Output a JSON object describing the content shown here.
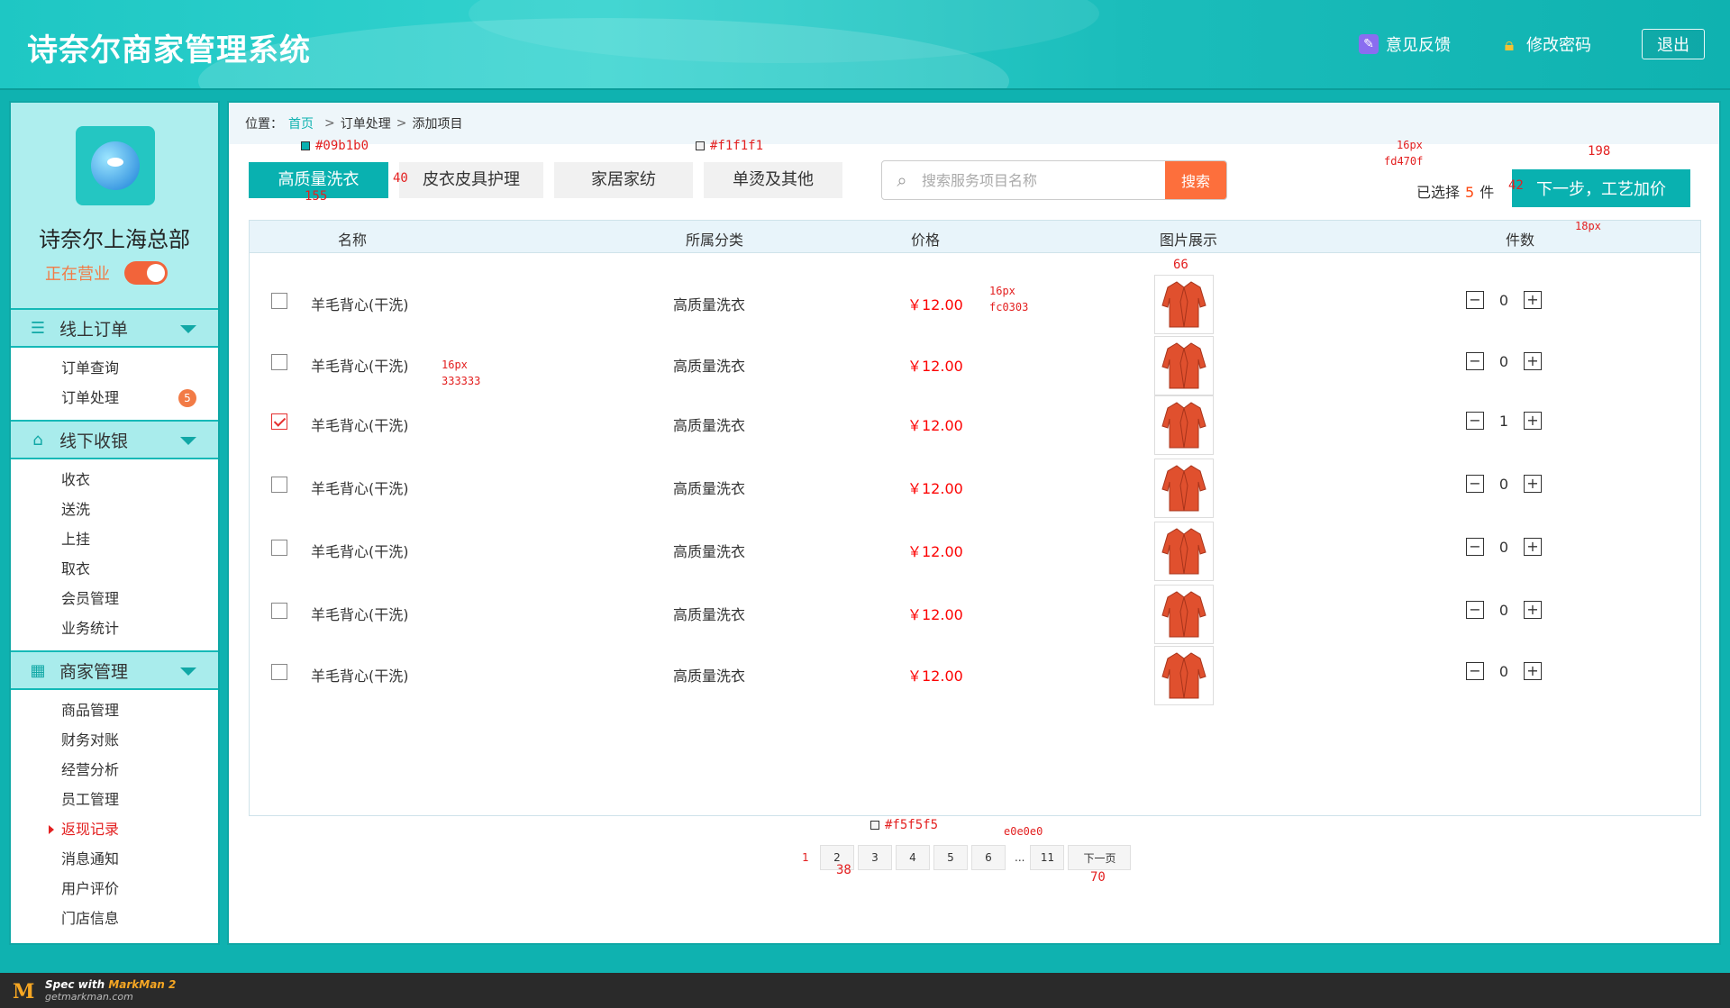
{
  "header": {
    "title": "诗奈尔商家管理系统",
    "feedback": "意见反馈",
    "change_password": "修改密码",
    "logout": "退出"
  },
  "sidebar": {
    "shop_name": "诗奈尔上海总部",
    "status": "正在营业",
    "status_on": true,
    "groups": [
      {
        "title": "线上订单",
        "icon": "clipboard-icon",
        "items": [
          {
            "label": "订单查询"
          },
          {
            "label": "订单处理",
            "badge": "5"
          }
        ]
      },
      {
        "title": "线下收银",
        "icon": "store-icon",
        "items": [
          {
            "label": "收衣"
          },
          {
            "label": "送洗"
          },
          {
            "label": "上挂"
          },
          {
            "label": "取衣"
          },
          {
            "label": "会员管理"
          },
          {
            "label": "业务统计"
          }
        ]
      },
      {
        "title": "商家管理",
        "icon": "grid-icon",
        "items": [
          {
            "label": "商品管理"
          },
          {
            "label": "财务对账"
          },
          {
            "label": "经营分析"
          },
          {
            "label": "员工管理"
          },
          {
            "label": "返现记录",
            "active": true
          },
          {
            "label": "消息通知"
          },
          {
            "label": "用户评价"
          },
          {
            "label": "门店信息"
          }
        ]
      }
    ]
  },
  "breadcrumb": {
    "prefix": "位置：",
    "home": "首页",
    "sep": ">",
    "level2": "订单处理",
    "level3": "添加项目"
  },
  "tabs": [
    {
      "label": "高质量洗衣",
      "active": true
    },
    {
      "label": "皮衣皮具护理"
    },
    {
      "label": "家居家纺"
    },
    {
      "label": "单烫及其他"
    }
  ],
  "search": {
    "placeholder": "搜索服务项目名称",
    "button": "搜索"
  },
  "selection": {
    "prefix": "已选择",
    "count": "5",
    "suffix": "件"
  },
  "next_button": "下一步，工艺加价",
  "table": {
    "headers": [
      "名称",
      "所属分类",
      "价格",
      "图片展示",
      "件数"
    ],
    "rows": [
      {
        "name": "羊毛背心(干洗)",
        "category": "高质量洗衣",
        "price": "￥12.00",
        "qty": "0",
        "checked": false
      },
      {
        "name": "羊毛背心(干洗)",
        "category": "高质量洗衣",
        "price": "￥12.00",
        "qty": "0",
        "checked": false
      },
      {
        "name": "羊毛背心(干洗)",
        "category": "高质量洗衣",
        "price": "￥12.00",
        "qty": "1",
        "checked": true
      },
      {
        "name": "羊毛背心(干洗)",
        "category": "高质量洗衣",
        "price": "￥12.00",
        "qty": "0",
        "checked": false
      },
      {
        "name": "羊毛背心(干洗)",
        "category": "高质量洗衣",
        "price": "￥12.00",
        "qty": "0",
        "checked": false
      },
      {
        "name": "羊毛背心(干洗)",
        "category": "高质量洗衣",
        "price": "￥12.00",
        "qty": "0",
        "checked": false
      },
      {
        "name": "羊毛背心(干洗)",
        "category": "高质量洗衣",
        "price": "￥12.00",
        "qty": "0",
        "checked": false
      }
    ]
  },
  "pager": {
    "current": "1",
    "pages": [
      "2",
      "3",
      "4",
      "5",
      "6"
    ],
    "ellipsis": "...",
    "last": "11",
    "next": "下一页"
  },
  "annotations": {
    "tab_color": "#09b1b0",
    "tab_height": "40",
    "tab_width": "155",
    "tab_bg": "#f1f1f1",
    "count_size": "16px",
    "count_color": "fd470f",
    "btn_width": "198",
    "btn_height": "42",
    "btn_font": "18px",
    "img_size": "66",
    "price_size": "16px",
    "price_color": "fc0303",
    "name_size": "16px",
    "name_color": "333333",
    "pager_bg": "#f5f5f5",
    "pager_border": "e0e0e0",
    "pager_w": "38",
    "pager_next_w": "70"
  },
  "footer": {
    "line1_prefix": "Spec with ",
    "line1_brand": "MarkMan 2",
    "line2": "getmarkman.com"
  },
  "colors": {
    "accent": "#09b1b0",
    "orange": "#fd6f3c",
    "price": "#fc0303",
    "count": "#fd470f"
  }
}
